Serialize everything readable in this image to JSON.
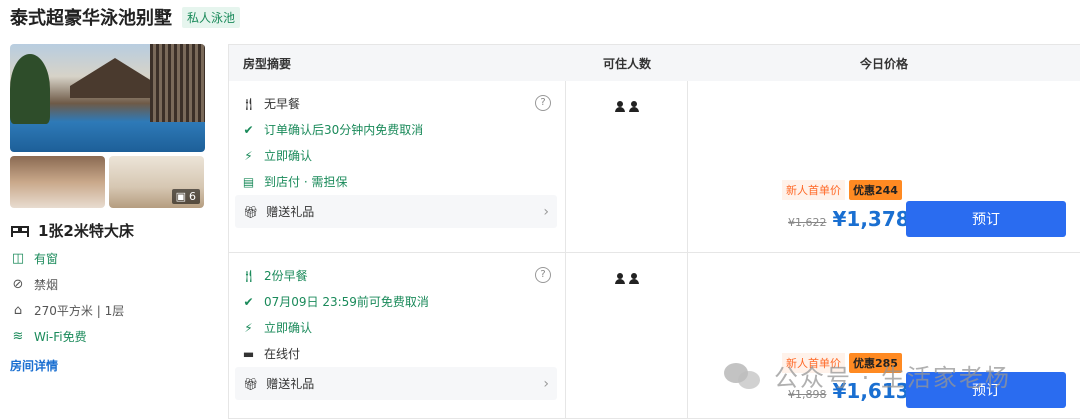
{
  "hotel": {
    "title": "泰式超豪华泳池别墅",
    "tag": "私人泳池"
  },
  "gallery": {
    "photo_count": "6"
  },
  "room": {
    "bed": "1张2米特大床",
    "facilities": [
      {
        "icon": "window-icon",
        "label": "有窗",
        "green": true
      },
      {
        "icon": "no-smoking-icon",
        "label": "禁烟",
        "green": false
      },
      {
        "icon": "area-icon",
        "label": "270平方米 | 1层",
        "green": false
      },
      {
        "icon": "wifi-icon",
        "label": "Wi-Fi免费",
        "green": true
      }
    ],
    "details_link": "房间详情"
  },
  "table": {
    "headers": [
      "房型摘要",
      "可住人数",
      "今日价格"
    ]
  },
  "rates": [
    {
      "features": [
        {
          "icon": "fork-knife-icon",
          "label": "无早餐",
          "green": false
        },
        {
          "icon": "check-circle-icon",
          "label": "订单确认后30分钟内免费取消",
          "green": true
        },
        {
          "icon": "lightning-icon",
          "label": "立即确认",
          "green": true
        },
        {
          "icon": "pay-at-hotel-icon",
          "label": "到店付 · 需担保",
          "green": true
        }
      ],
      "gift": "赠送礼品",
      "occupancy": 2,
      "promo_label": "新人首单价",
      "promo_badge": "优惠244",
      "old_price": "¥1,622",
      "new_price": "¥1,378",
      "book_label": "预订"
    },
    {
      "features": [
        {
          "icon": "fork-knife-icon",
          "label": "2份早餐",
          "green": true
        },
        {
          "icon": "check-circle-icon",
          "label": "07月09日 23:59前可免费取消",
          "green": true
        },
        {
          "icon": "lightning-icon",
          "label": "立即确认",
          "green": true
        },
        {
          "icon": "card-icon",
          "label": "在线付",
          "green": false
        }
      ],
      "gift": "赠送礼品",
      "occupancy": 2,
      "promo_label": "新人首单价",
      "promo_badge": "优惠285",
      "old_price": "¥1,898",
      "new_price": "¥1,613",
      "book_label": "预订"
    }
  ],
  "watermark": "公众号 · 生活家老杨",
  "colors": {
    "accent_blue": "#2a6cf0",
    "price_blue": "#1a6fd1",
    "green": "#1a8a5a",
    "promo_orange": "#ff8a22"
  }
}
